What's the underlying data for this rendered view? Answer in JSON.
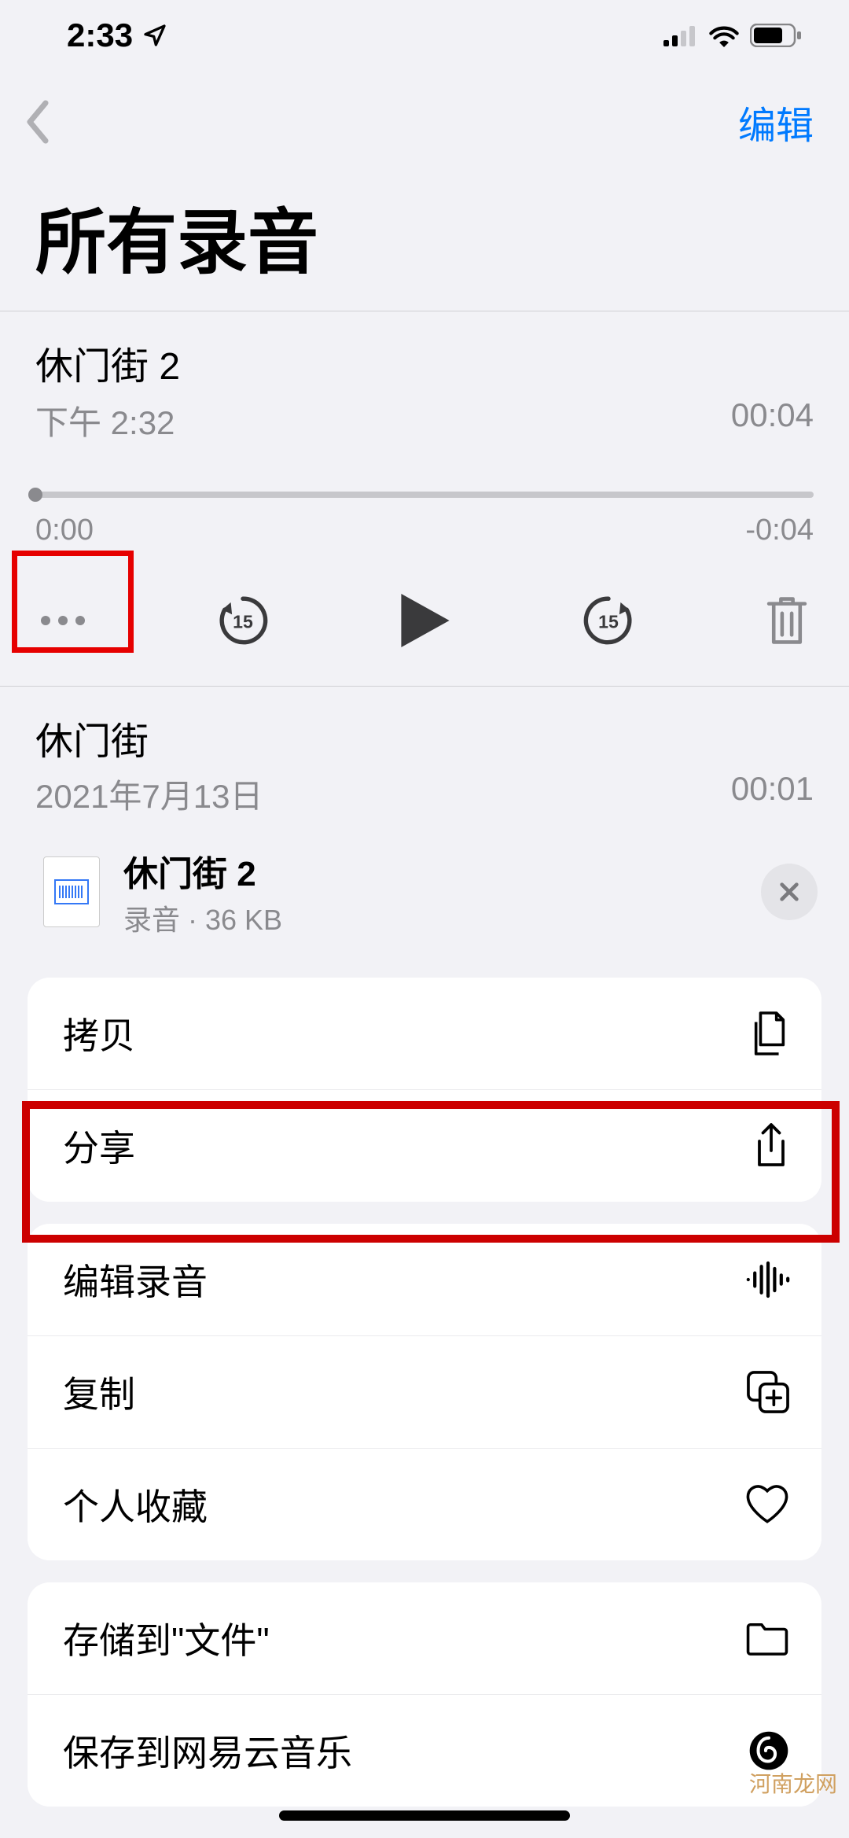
{
  "status": {
    "time": "2:33"
  },
  "nav": {
    "edit": "编辑"
  },
  "page": {
    "title": "所有录音"
  },
  "recording_expanded": {
    "title": "休门街 2",
    "subtitle": "下午 2:32",
    "duration": "00:04",
    "time_start": "0:00",
    "time_end": "-0:04"
  },
  "recording_row": {
    "title": "休门街",
    "date": "2021年7月13日",
    "duration": "00:01"
  },
  "sheet": {
    "file_title": "休门街 2",
    "file_sub": "录音 · 36 KB",
    "group1": [
      {
        "label": "拷贝",
        "icon": "copy-doc"
      },
      {
        "label": "分享",
        "icon": "share"
      }
    ],
    "group2": [
      {
        "label": "编辑录音",
        "icon": "waveform"
      },
      {
        "label": "复制",
        "icon": "duplicate"
      },
      {
        "label": "个人收藏",
        "icon": "heart"
      }
    ],
    "group3": [
      {
        "label": "存储到\"文件\"",
        "icon": "folder"
      },
      {
        "label": "保存到网易云音乐",
        "icon": "netease"
      }
    ]
  },
  "watermark": "河南龙网"
}
